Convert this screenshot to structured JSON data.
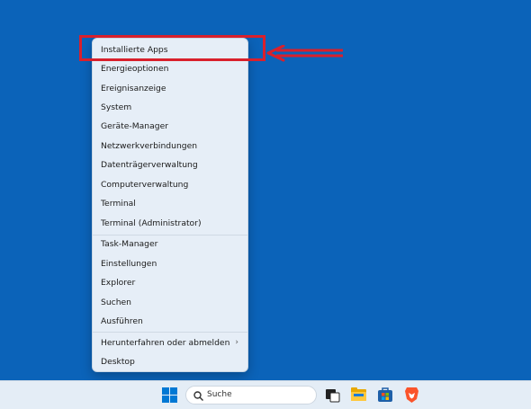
{
  "menu": {
    "group1": [
      "Installierte Apps",
      "Energieoptionen",
      "Ereignisanzeige",
      "System",
      "Geräte-Manager",
      "Netzwerkverbindungen",
      "Datenträgerverwaltung",
      "Computerverwaltung",
      "Terminal",
      "Terminal (Administrator)"
    ],
    "group2": [
      "Task-Manager",
      "Einstellungen",
      "Explorer",
      "Suchen",
      "Ausführen"
    ],
    "group3": [
      "Herunterfahren oder abmelden",
      "Desktop"
    ]
  },
  "taskbar": {
    "search_label": "Suche",
    "icons": [
      "windows-start-icon",
      "search-icon",
      "task-view-icon",
      "file-explorer-icon",
      "microsoft-store-icon",
      "brave-browser-icon"
    ]
  },
  "colors": {
    "desktop": "#0b63b9",
    "highlight": "#d9202c",
    "menu_bg": "#e6eef7"
  }
}
